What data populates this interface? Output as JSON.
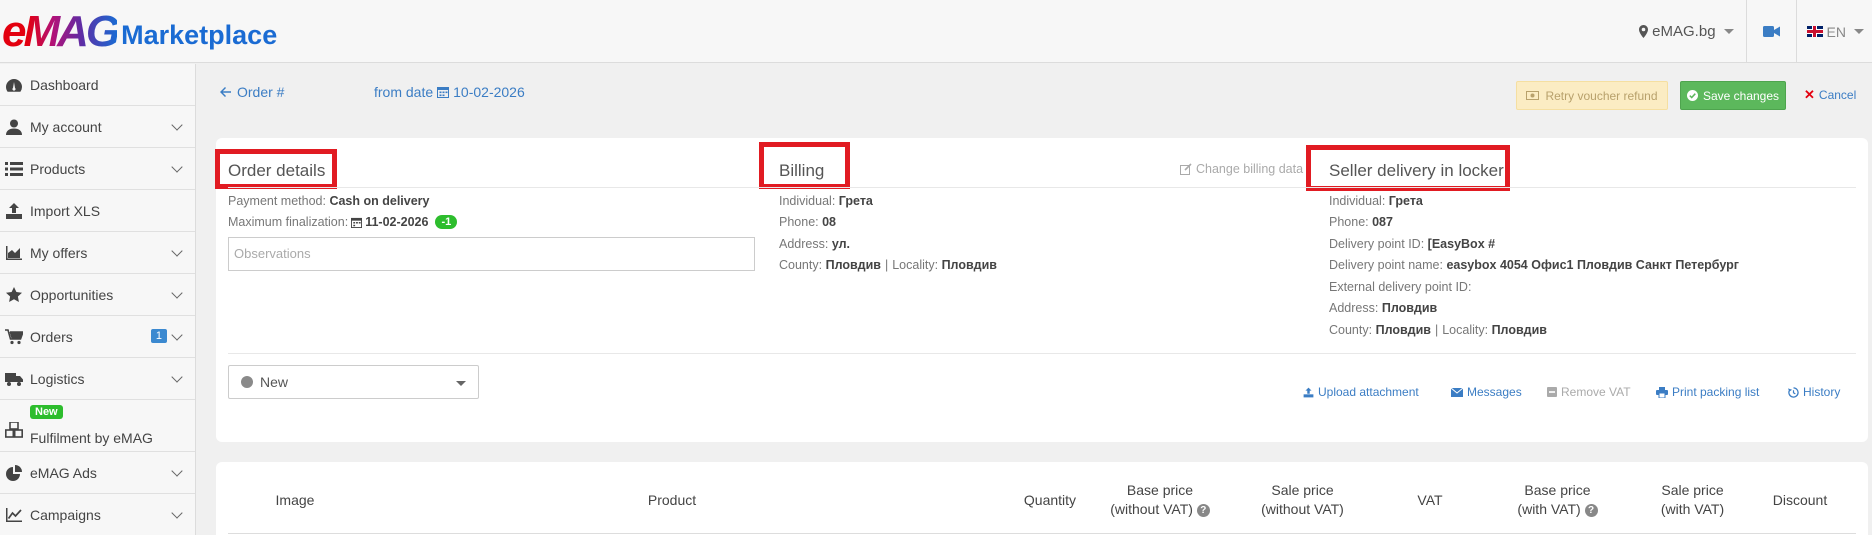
{
  "brand": {
    "logo_main": "eMAG",
    "logo_sub": "Marketplace",
    "accent": "#3b7dc4"
  },
  "topbar": {
    "store": "eMAG.bg",
    "lang": "EN"
  },
  "sidebar": {
    "items": [
      {
        "label": "Dashboard",
        "icon": "dashboard-icon"
      },
      {
        "label": "My account",
        "icon": "user-icon"
      },
      {
        "label": "Products",
        "icon": "list-icon"
      },
      {
        "label": "Import XLS",
        "icon": "upload-icon"
      },
      {
        "label": "My offers",
        "icon": "area-chart-icon"
      },
      {
        "label": "Opportunities",
        "icon": "star-icon"
      },
      {
        "label": "Orders",
        "icon": "cart-icon",
        "badge": "1"
      },
      {
        "label": "Logistics",
        "icon": "truck-icon"
      },
      {
        "label": "Fulfilment by eMAG",
        "icon": "cubes-icon",
        "tag": "New"
      },
      {
        "label": "eMAG Ads",
        "icon": "pie-chart-icon"
      },
      {
        "label": "Campaigns",
        "icon": "line-chart-icon"
      }
    ]
  },
  "header": {
    "order_label": "Order #",
    "from_date_label": "from date",
    "from_date_value": "10-02-2026",
    "retry_label": "Retry voucher refund",
    "save_label": "Save changes",
    "cancel_label": "Cancel"
  },
  "order_details": {
    "title": "Order details",
    "payment_method_label": "Payment method:",
    "payment_method_value": "Cash on delivery",
    "max_finalization_label": "Maximum finalization:",
    "max_finalization_value": "11-02-2026",
    "max_finalization_badge": "-1",
    "observations_placeholder": "Observations"
  },
  "billing": {
    "title": "Billing",
    "change_label": "Change billing data",
    "individual_label": "Individual:",
    "individual_value": "Грета",
    "phone_label": "Phone:",
    "phone_value": "08",
    "address_label": "Address:",
    "address_value": "ул. ",
    "county_label": "County:",
    "county_value": "Пловдив",
    "locality_label": "Locality:",
    "locality_value": "Пловдив"
  },
  "delivery": {
    "title": "Seller delivery in locker",
    "individual_label": "Individual:",
    "individual_value": "Грета",
    "phone_label": "Phone:",
    "phone_value": "087",
    "dp_id_label": "Delivery point ID:",
    "dp_id_value": "[EasyBox #",
    "dp_name_label": "Delivery point name:",
    "dp_name_value": "easybox 4054 Офис1 Пловдив Санкт Петербург",
    "ext_id_label": "External delivery point ID:",
    "address_label": "Address:",
    "address_value": "Пловдив",
    "county_label": "County:",
    "county_value": "Пловдив",
    "locality_label": "Locality:",
    "locality_value": "Пловдив"
  },
  "status": {
    "value": "New"
  },
  "actions": {
    "upload": "Upload attachment",
    "messages": "Messages",
    "remove_vat": "Remove VAT",
    "print": "Print packing list",
    "history": "History"
  },
  "table": {
    "headers": {
      "image": "Image",
      "product": "Product",
      "quantity": "Quantity",
      "base_price_l1": "Base price",
      "base_price_l2": "(without VAT)",
      "sale_price_l1": "Sale price",
      "sale_price_l2": "(without VAT)",
      "vat": "VAT",
      "base_price_vat_l1": "Base price",
      "base_price_vat_l2": "(with VAT)",
      "sale_price_vat_l1": "Sale price",
      "sale_price_vat_l2": "(with VAT)",
      "discount": "Discount"
    }
  }
}
